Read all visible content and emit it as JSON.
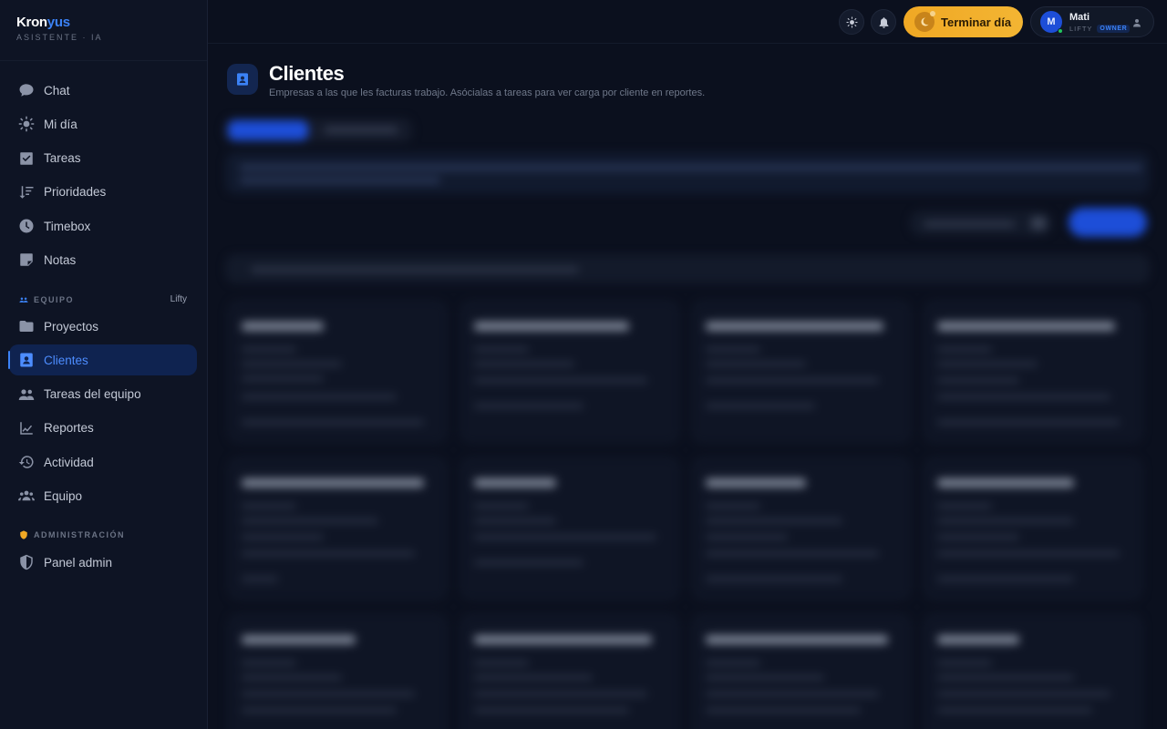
{
  "brand": {
    "name_main": "Kron",
    "name_accent": "yus",
    "subtitle": "ASISTENTE · IA"
  },
  "nav_main": [
    {
      "label": "Chat",
      "icon": "chat-icon"
    },
    {
      "label": "Mi día",
      "icon": "sun-icon"
    },
    {
      "label": "Tareas",
      "icon": "checkbox-icon"
    },
    {
      "label": "Prioridades",
      "icon": "sort-priority-icon"
    },
    {
      "label": "Timebox",
      "icon": "clock-icon"
    },
    {
      "label": "Notas",
      "icon": "note-icon"
    }
  ],
  "team_section": {
    "label": "EQUIPO",
    "org": "Lifty",
    "icon": "team-small-icon"
  },
  "nav_team": [
    {
      "label": "Proyectos",
      "icon": "folder-icon"
    },
    {
      "label": "Clientes",
      "icon": "contact-card-icon",
      "active": true
    },
    {
      "label": "Tareas del equipo",
      "icon": "people-icon"
    },
    {
      "label": "Reportes",
      "icon": "chart-line-icon"
    },
    {
      "label": "Actividad",
      "icon": "history-icon"
    },
    {
      "label": "Equipo",
      "icon": "group-icon"
    }
  ],
  "admin_section": {
    "label": "ADMINISTRACIÓN",
    "icon": "shield-small-icon"
  },
  "nav_admin": [
    {
      "label": "Panel admin",
      "icon": "shield-icon"
    }
  ],
  "topbar": {
    "end_day_label": "Terminar día",
    "user": {
      "initial": "M",
      "name": "Mati",
      "org": "LIFTY",
      "role": "OWNER"
    }
  },
  "page": {
    "title": "Clientes",
    "subtitle": "Empresas a las que les facturas trabajo. Asócialas a tareas para ver carga por cliente en reportes."
  },
  "colors": {
    "accent": "#3b82f6",
    "end_day": "#f0a824",
    "background": "#0b101e",
    "sidebar": "#0e1424"
  }
}
